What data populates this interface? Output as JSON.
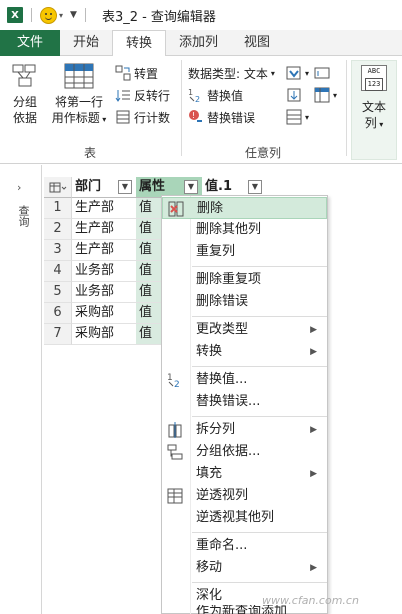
{
  "titlebar": {
    "app_icon": "X",
    "title": "表3_2 - 查询编辑器"
  },
  "tabs": [
    {
      "label": "文件"
    },
    {
      "label": "开始"
    },
    {
      "label": "转换"
    },
    {
      "label": "添加列"
    },
    {
      "label": "视图"
    }
  ],
  "ribbon": {
    "group_table_label": "表",
    "group_anycol_label": "任意列",
    "group_by_line1": "分组",
    "group_by_line2": "依据",
    "first_row_line1": "将第一行",
    "first_row_line2": "用作标题",
    "transpose": "转置",
    "reverse_rows": "反转行",
    "count_rows": "行计数",
    "data_type": "数据类型: 文本",
    "replace_values": "替换值",
    "replace_errors": "替换错误",
    "text_col_line1": "文本",
    "text_col_line2": "列",
    "abc_icon_text": "ABC",
    "abc_icon_num": "123"
  },
  "left_pane": {
    "label": "查询"
  },
  "table": {
    "headers": [
      "部门",
      "属性",
      "值.1"
    ],
    "rows": [
      {
        "num": "1",
        "dept": "生产部",
        "attr": "值"
      },
      {
        "num": "2",
        "dept": "生产部",
        "attr": "值"
      },
      {
        "num": "3",
        "dept": "生产部",
        "attr": "值"
      },
      {
        "num": "4",
        "dept": "业务部",
        "attr": "值"
      },
      {
        "num": "5",
        "dept": "业务部",
        "attr": "值"
      },
      {
        "num": "6",
        "dept": "采购部",
        "attr": "值"
      },
      {
        "num": "7",
        "dept": "采购部",
        "attr": "值"
      }
    ]
  },
  "context_menu": {
    "delete": "删除",
    "delete_other": "删除其他列",
    "duplicate": "重复列",
    "remove_duplicates": "删除重复项",
    "remove_errors": "删除错误",
    "change_type": "更改类型",
    "transform": "转换",
    "replace_values": "替换值...",
    "replace_errors": "替换错误...",
    "split_column": "拆分列",
    "group_by": "分组依据...",
    "fill": "填充",
    "unpivot": "逆透视列",
    "unpivot_other": "逆透视其他列",
    "rename": "重命名...",
    "move": "移动",
    "drill_down": "深化",
    "add_as_new_query": "作为新查询添加"
  },
  "watermark": "www.cfan.com.cn",
  "colors": {
    "excel_green": "#217346",
    "highlight": "#d3eadb",
    "selected_col": "#d9ebe0"
  }
}
